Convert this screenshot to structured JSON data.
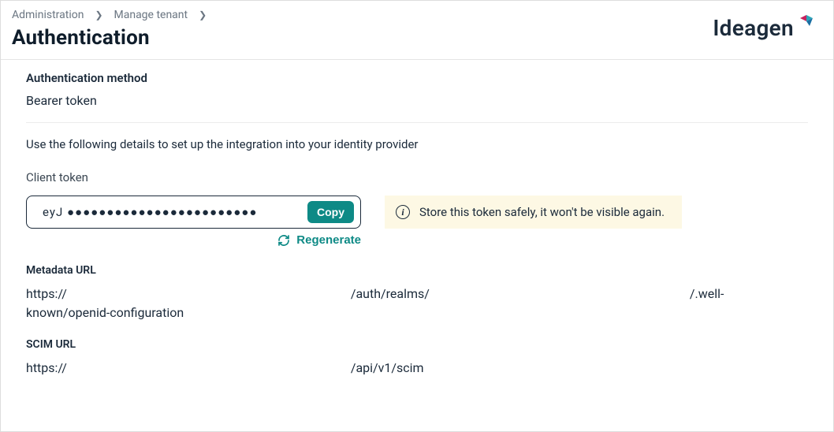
{
  "breadcrumb": {
    "item1": "Administration",
    "item2": "Manage tenant"
  },
  "pageTitle": "Authentication",
  "logo": {
    "text": "Ideagen"
  },
  "authMethod": {
    "label": "Authentication method",
    "value": "Bearer token"
  },
  "instruction": "Use the following details to set up the integration into your identity provider",
  "clientToken": {
    "label": "Client token",
    "maskedValue": "eyJ ●●●●●●●●●●●●●●●●●●●●●●●●",
    "copyLabel": "Copy",
    "regenerateLabel": "Regenerate"
  },
  "infoBox": {
    "text": "Store this token safely, it won't be visible again."
  },
  "metadataUrl": {
    "label": "Metadata URL",
    "seg1": "https://",
    "seg2": "/auth/realms/",
    "seg3": "/.well-",
    "seg4": "known/openid-configuration"
  },
  "scimUrl": {
    "label": "SCIM URL",
    "seg1": "https://",
    "seg2": "/api/v1/scim"
  }
}
